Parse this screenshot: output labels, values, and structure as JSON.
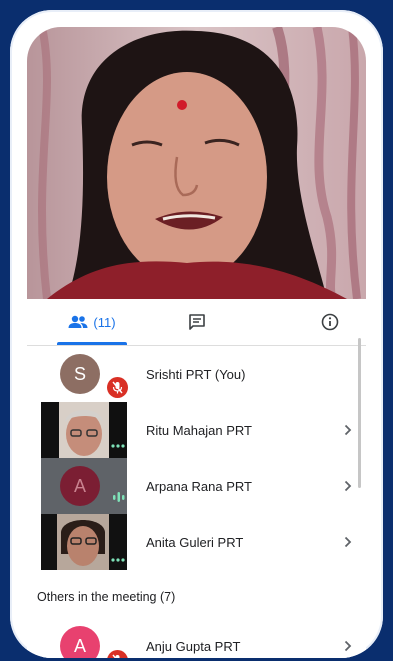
{
  "tabs": {
    "people_count": "(11)"
  },
  "participants": [
    {
      "name": "Srishti PRT (You)",
      "avatar_letter": "S",
      "avatar_color": "#8d6e63",
      "muted": true
    },
    {
      "name": "Ritu Mahajan PRT",
      "has_video": true,
      "speaking_dots": true
    },
    {
      "name": "Arpana Rana PRT",
      "avatar_letter": "A",
      "avatar_color": "#7b1e33",
      "speaking": true
    },
    {
      "name": "Anita Guleri PRT",
      "has_video": true,
      "speaking_dots": true
    }
  ],
  "others": {
    "title": "Others in the meeting (7)",
    "first": {
      "name": "Anju Gupta PRT",
      "avatar_letter": "A",
      "avatar_color": "#e8416f",
      "muted": true
    }
  },
  "colors": {
    "accent": "#1a73e8",
    "muted_red": "#d93025",
    "background": "#0a2e6e"
  }
}
